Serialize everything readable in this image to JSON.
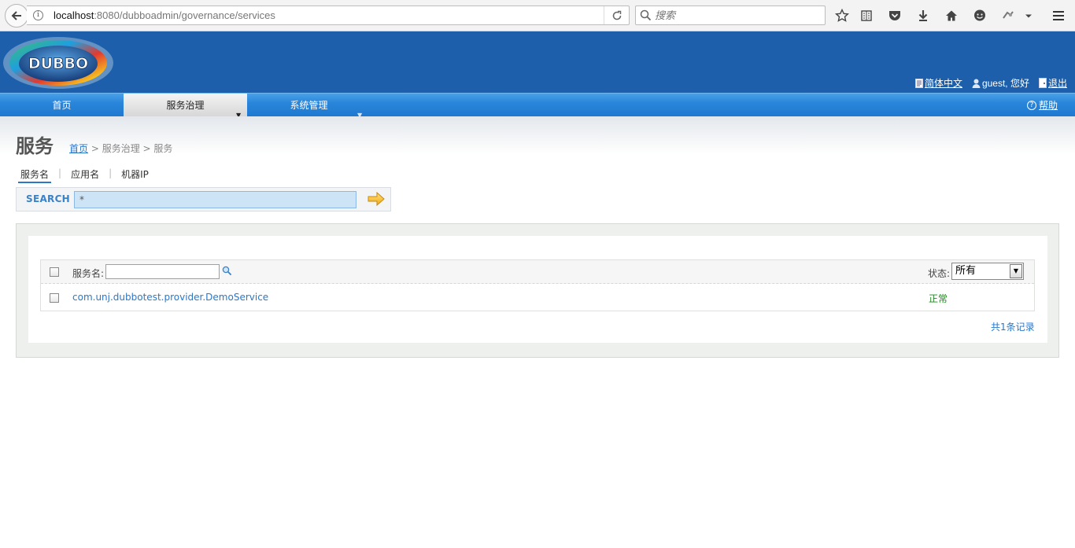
{
  "browser": {
    "url_host": "localhost",
    "url_path": ":8080/dubboadmin/governance/services",
    "search_placeholder": "搜索"
  },
  "header": {
    "logo_text": "DUBBO",
    "language_label": "简体中文",
    "greeting": "guest, 您好",
    "logout_label": "退出"
  },
  "nav": {
    "items": [
      {
        "label": "首页"
      },
      {
        "label": "服务治理"
      },
      {
        "label": "系统管理"
      }
    ],
    "help_label": "帮助"
  },
  "page": {
    "title": "服务",
    "breadcrumb": {
      "home": "首页",
      "rest": "> 服务治理 > 服务"
    }
  },
  "tabs": [
    {
      "label": "服务名"
    },
    {
      "label": "应用名"
    },
    {
      "label": "机器IP"
    }
  ],
  "search": {
    "label": "SEARCH",
    "value": "*"
  },
  "table": {
    "service_name_label": "服务名:",
    "status_label": "状态:",
    "status_selected": "所有",
    "rows": [
      {
        "service": "com.unj.dubbotest.provider.DemoService",
        "status": "正常"
      }
    ],
    "total": "共1条记录"
  },
  "colors": {
    "header_blue": "#1d5fab",
    "nav_blue": "#2a86da",
    "link_blue": "#2a78c8",
    "status_green": "#1a8a1a"
  }
}
